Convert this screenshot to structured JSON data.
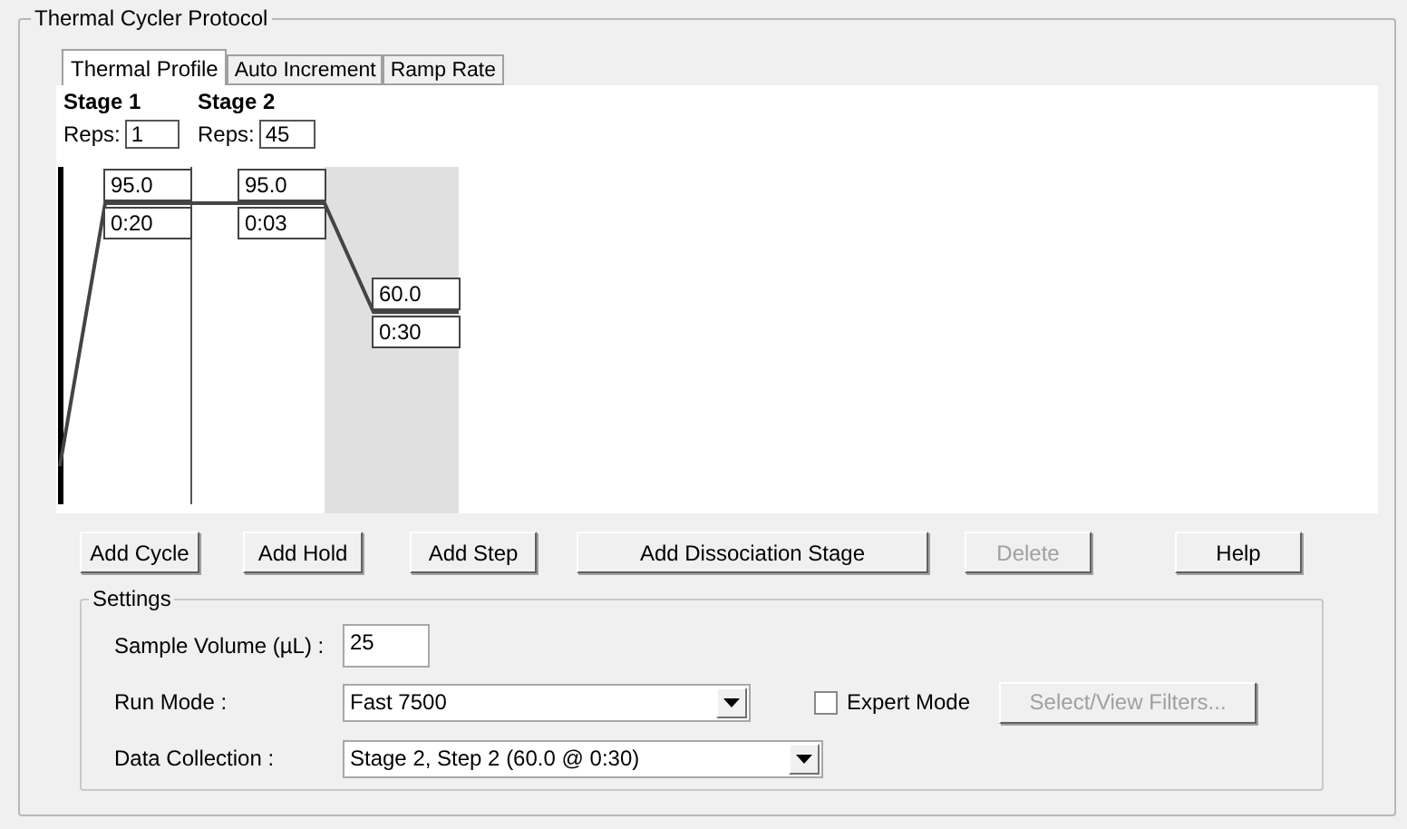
{
  "group_title": "Thermal Cycler Protocol",
  "tabs": [
    {
      "label": "Thermal Profile",
      "selected": true
    },
    {
      "label": "Auto Increment",
      "selected": false
    },
    {
      "label": "Ramp Rate",
      "selected": false
    }
  ],
  "stages": [
    {
      "label": "Stage 1",
      "reps_label": "Reps:",
      "reps": "1",
      "steps": [
        {
          "temperature": "95.0",
          "time": "0:20",
          "selected": false
        }
      ]
    },
    {
      "label": "Stage 2",
      "reps_label": "Reps:",
      "reps": "45",
      "steps": [
        {
          "temperature": "95.0",
          "time": "0:03",
          "selected": false
        },
        {
          "temperature": "60.0",
          "time": "0:30",
          "selected": true
        }
      ]
    }
  ],
  "buttons": [
    {
      "label": "Add Cycle",
      "disabled": false
    },
    {
      "label": "Add Hold",
      "disabled": false
    },
    {
      "label": "Add Step",
      "disabled": false
    },
    {
      "label": "Add Dissociation Stage",
      "disabled": false
    },
    {
      "label": "Delete",
      "disabled": true
    },
    {
      "label": "Help",
      "disabled": false
    }
  ],
  "settings": {
    "title": "Settings",
    "sample_volume": {
      "label": "Sample Volume (µL) :",
      "value": "25"
    },
    "run_mode": {
      "label": "Run Mode :",
      "value": "Fast 7500"
    },
    "expert_mode": {
      "label": "Expert Mode",
      "checked": false
    },
    "filters_button": {
      "label": "Select/View Filters...",
      "disabled": true
    },
    "data_collection": {
      "label": "Data Collection :",
      "value": "Stage 2, Step 2 (60.0 @ 0:30)"
    }
  }
}
